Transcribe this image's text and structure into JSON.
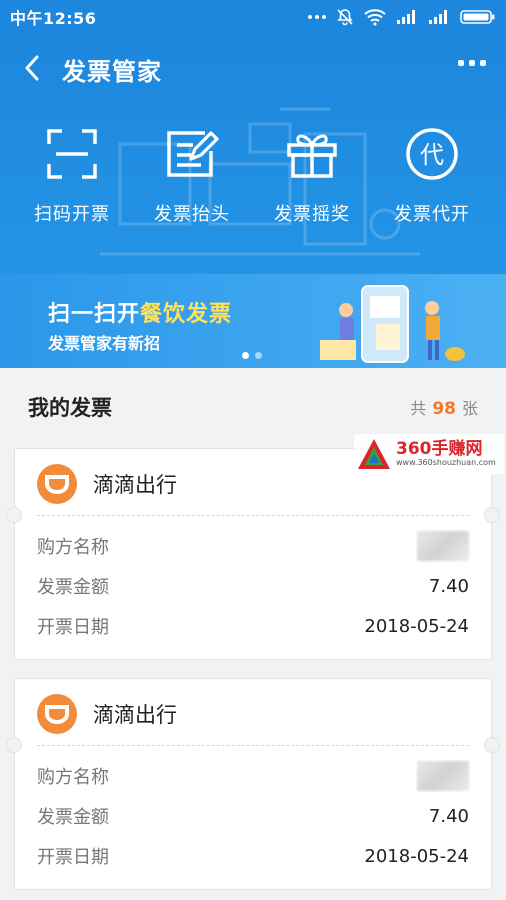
{
  "status_bar": {
    "time": "中午12:56"
  },
  "header": {
    "title": "发票管家"
  },
  "tools": [
    {
      "label": "扫码开票",
      "icon": "scan-icon"
    },
    {
      "label": "发票抬头",
      "icon": "edit-icon"
    },
    {
      "label": "发票摇奖",
      "icon": "gift-icon"
    },
    {
      "label": "发票代开",
      "icon": "dai-icon",
      "glyph": "代"
    }
  ],
  "banner": {
    "line1_pre": "扫一扫开",
    "line1_highlight": "餐饮发票",
    "line2": "发票管家有新招"
  },
  "section": {
    "title": "我的发票",
    "count_prefix": "共",
    "count": "98",
    "count_suffix": "张"
  },
  "invoices": [
    {
      "vendor": "滴滴出行",
      "buyer_label": "购方名称",
      "amount_label": "发票金额",
      "amount": "7.40",
      "date_label": "开票日期",
      "date": "2018-05-24"
    },
    {
      "vendor": "滴滴出行",
      "buyer_label": "购方名称",
      "amount_label": "发票金额",
      "amount": "7.40",
      "date_label": "开票日期",
      "date": "2018-05-24"
    }
  ],
  "watermark": {
    "name": "360手赚网",
    "url": "www.360shouzhuan.com"
  },
  "colors": {
    "primary": "#1d87dd",
    "accent_orange": "#f07a26",
    "highlight_yellow": "#ffe15a"
  }
}
